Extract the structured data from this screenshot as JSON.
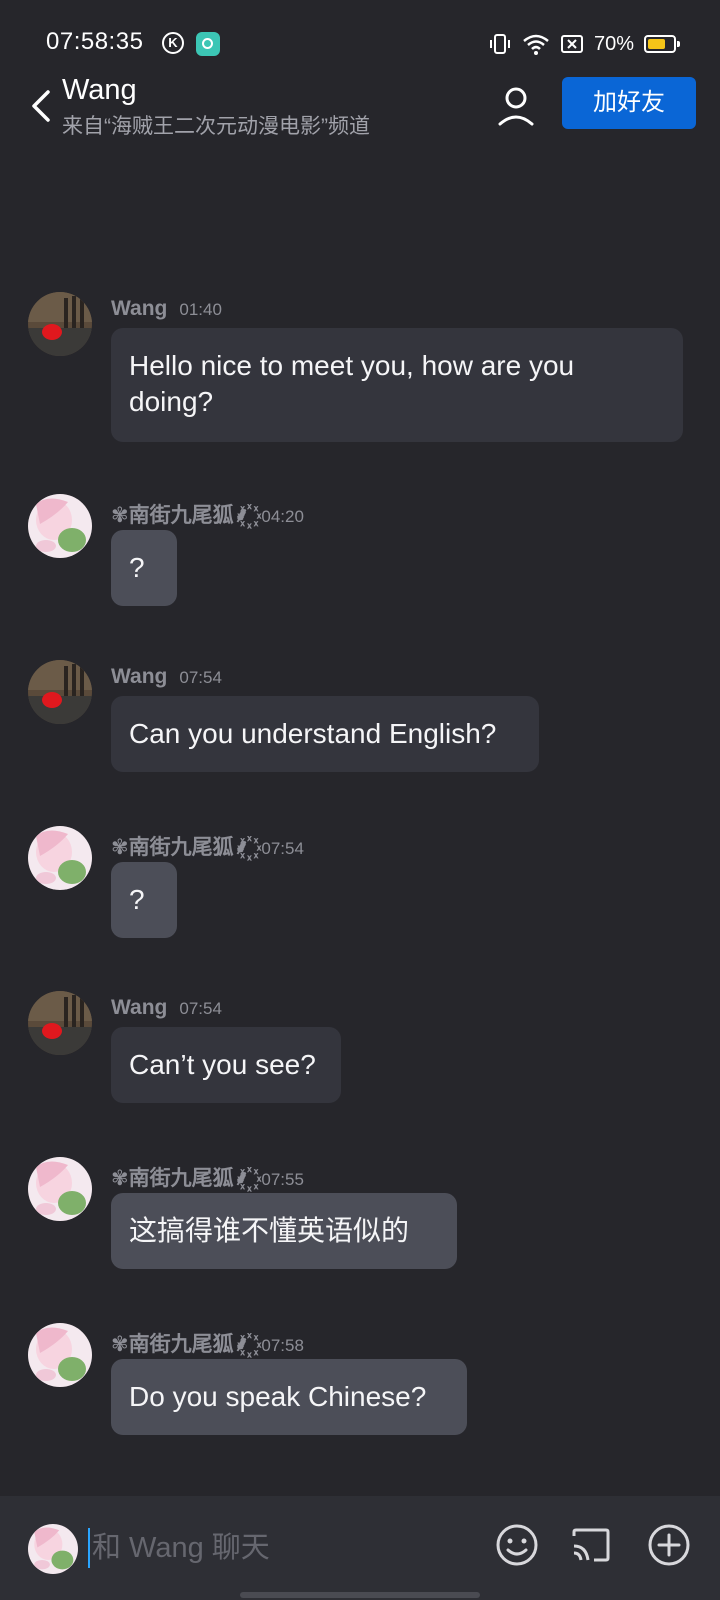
{
  "status_bar": {
    "time": "07:58:35",
    "battery_percent": "70%",
    "battery_level": 0.7,
    "battery_color": "#f5c518"
  },
  "header": {
    "title": "Wang",
    "subtitle": "来自“海贼王二次元动漫电影”频道",
    "add_friend_label": "加好友"
  },
  "messages": [
    {
      "sender": "Wang",
      "time": "01:40",
      "text": "Hello nice to meet you, how are you doing?",
      "side": "other"
    },
    {
      "sender": "✾南街九尾狐⸙꙰",
      "time": "04:20",
      "text": "?",
      "side": "self"
    },
    {
      "sender": "Wang",
      "time": "07:54",
      "text": "Can you understand English?",
      "side": "other"
    },
    {
      "sender": "✾南街九尾狐⸙꙰",
      "time": "07:54",
      "text": "?",
      "side": "self"
    },
    {
      "sender": "Wang",
      "time": "07:54",
      "text": "Can’t you see?",
      "side": "other"
    },
    {
      "sender": "✾南街九尾狐⸙꙰",
      "time": "07:55",
      "text": "这搞得谁不懂英语似的",
      "side": "self"
    },
    {
      "sender": "✾南街九尾狐⸙꙰",
      "time": "07:58",
      "text": "Do you speak Chinese?",
      "side": "self"
    }
  ],
  "input": {
    "placeholder": "和 Wang 聊天",
    "value": ""
  },
  "icons": {
    "back": "chevron-left-icon",
    "profile": "person-icon",
    "emoji": "smiley-icon",
    "cast": "cast-icon",
    "add": "plus-circle-icon"
  },
  "colors": {
    "background": "#26262b",
    "accent": "#0a66d6",
    "bubble_other": "#34353d",
    "bubble_self": "#4c4e58"
  }
}
